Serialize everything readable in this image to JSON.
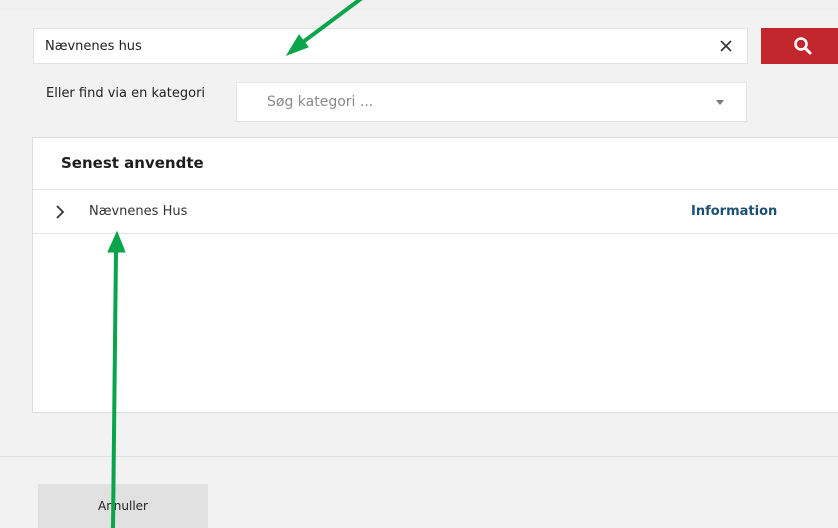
{
  "search": {
    "value": "Nævnenes hus",
    "clear_glyph": "×"
  },
  "category": {
    "label": "Eller find via en kategori",
    "placeholder": "Søg kategori ..."
  },
  "recent": {
    "title": "Senest anvendte",
    "items": [
      {
        "name": "Nævnenes Hus",
        "link": "Information"
      }
    ]
  },
  "footer": {
    "cancel_label": "Annuller"
  },
  "colors": {
    "accent": "#c1272d",
    "link": "#1d4f73",
    "annotation_arrow": "#0aa44a"
  },
  "icons": {
    "search_button": "search-icon",
    "clear": "close-icon",
    "dropdown": "caret-down-icon",
    "row_expand": "chevron-right-icon"
  }
}
